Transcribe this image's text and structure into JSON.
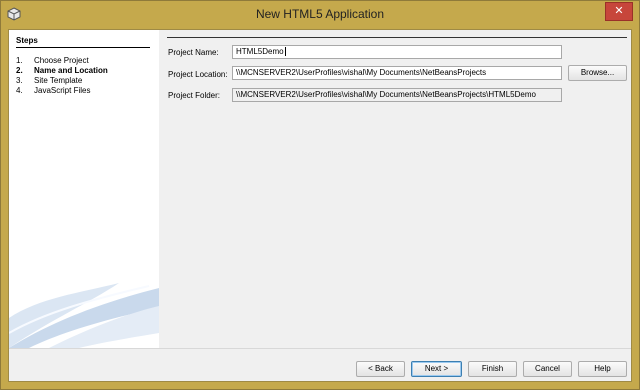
{
  "window": {
    "title": "New HTML5 Application",
    "close_label": "✕"
  },
  "steps": {
    "heading": "Steps",
    "items": [
      {
        "num": "1.",
        "label": "Choose Project"
      },
      {
        "num": "2.",
        "label": "Name and Location"
      },
      {
        "num": "3.",
        "label": "Site Template"
      },
      {
        "num": "4.",
        "label": "JavaScript Files"
      }
    ]
  },
  "form": {
    "project_name_label": "Project Name:",
    "project_name_value": "HTML5Demo",
    "project_location_label": "Project Location:",
    "project_location_value": "\\\\MCNSERVER2\\UserProfiles\\vishal\\My Documents\\NetBeansProjects",
    "browse_label": "Browse...",
    "project_folder_label": "Project Folder:",
    "project_folder_value": "\\\\MCNSERVER2\\UserProfiles\\vishal\\My Documents\\NetBeansProjects\\HTML5Demo"
  },
  "buttons": {
    "back": "< Back",
    "next": "Next >",
    "finish": "Finish",
    "cancel": "Cancel",
    "help": "Help"
  },
  "colors": {
    "titlebar": "#c5a94c",
    "close": "#c7463b",
    "dialog_bg": "#f0f0f0"
  },
  "icons": [
    "app-cube-icon",
    "close-icon"
  ]
}
